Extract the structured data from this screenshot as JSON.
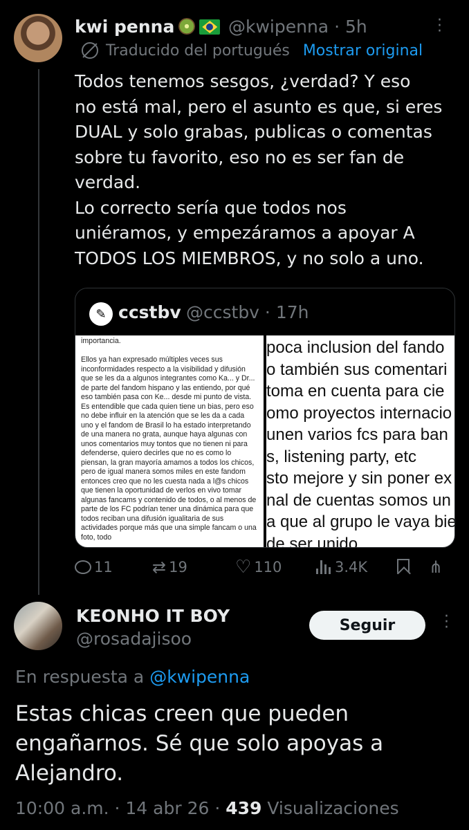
{
  "tweet": {
    "author_name": "kwi penna",
    "author_handle": "@kwipenna",
    "time_ago": "5h",
    "translated_label": "Traducido del portugués",
    "show_original_label": "Mostrar original",
    "text": "Todos tenemos sesgos, ¿verdad? Y eso\nno está mal, pero el asunto es que, si eres\nDUAL y solo grabas, publicas o comentas\nsobre tu favorito, eso no es ser fan de\nverdad.\nLo correcto sería que todos nos\nuniéramos, y empezáramos a apoyar A\nTODOS LOS MIEMBROS, y no solo a uno.",
    "quote": {
      "author_name": "ccstbv",
      "author_handle": "@ccstbv",
      "time_ago": "17h",
      "image_left_text": "importancia.\n\nEllos ya han expresado múltiples veces sus inconformidades respecto a la visibilidad y difusión que se les da a algunos integrantes como Ka... y Dr... de parte del fandom hispano y las entiendo, por qué eso también pasa con Ke... desde mi punto de vista.\nEs entendible que cada quien tiene un bias, pero eso no debe influir en la atención que se les da a cada uno y el fandom de Brasil lo ha estado interpretando de una manera no grata, aunque haya algunas con unos comentarios muy tontos que no tienen ni para defenderse, quiero decirles que no es como lo piensan, la gran mayoría amamos a todos los chicos, pero de igual manera somos miles en este fandom entonces creo que no les cuesta nada a l@s chicos que tienen la oportunidad de verlos en vivo tomar algunas fancams y contenido de todos, o al menos de parte de los FC podrían tener una dinámica para que todos reciban una difusión igualitaria de sus actividades porque más que una simple fancam o una foto, todo",
      "image_right_lines": [
        "poca inclusion del fando",
        "o también sus comentari",
        "toma en cuenta para cie",
        "omo proyectos internacio",
        "unen varios fcs para ban",
        "s, listening party, etc",
        "sto mejore y sin poner ex",
        "nal de cuentas somos un",
        "a que al grupo le vaya bie",
        "de ser unido"
      ]
    },
    "stats": {
      "replies": "11",
      "retweets": "19",
      "likes": "110",
      "views": "3.4K"
    }
  },
  "reply": {
    "author_name": "KEONHO IT BOY",
    "author_handle": "@rosadajisoo",
    "follow_label": "Seguir",
    "in_reply_to_prefix": "En respuesta a",
    "in_reply_to_handle": "@kwipenna",
    "text": "Estas chicas creen que pueden engañarnos. Sé que solo apoyas a Alejandro.",
    "time": "10:00 a.m.",
    "date": "14 abr 26",
    "views_count": "439",
    "views_label": "Visualizaciones"
  },
  "colors": {
    "background": "#000000",
    "text_primary": "#e7e9ea",
    "text_secondary": "#71767b",
    "link": "#1d9bf0",
    "follow_bg": "#eff3f4"
  },
  "icons": [
    "more-icon",
    "translate-icon",
    "reply-icon",
    "retweet-icon",
    "like-icon",
    "views-icon",
    "bookmark-icon",
    "share-icon"
  ]
}
